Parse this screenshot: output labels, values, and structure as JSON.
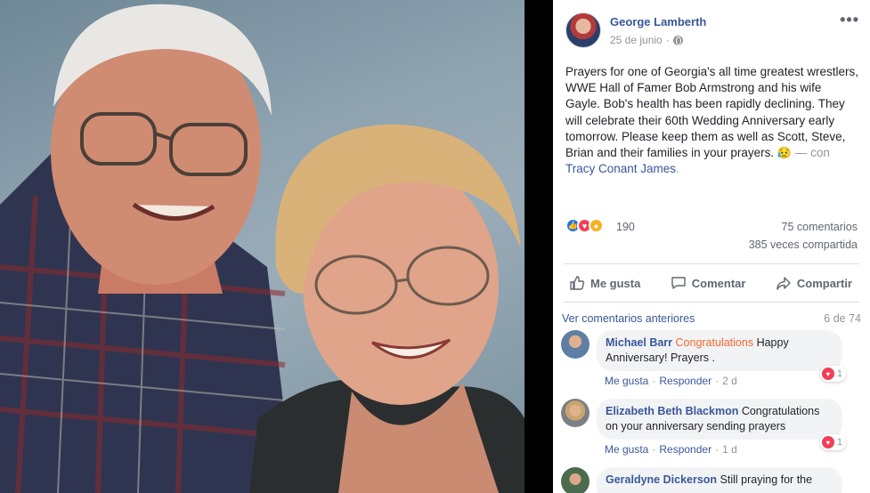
{
  "post": {
    "author": "George Lamberth",
    "date": "25 de junio",
    "dot": "·",
    "more": "•••",
    "text": "Prayers for one of Georgia's all time greatest wrestlers, WWE Hall of Famer Bob Armstrong and his wife Gayle. Bob's health has been rapidly declining. They will celebrate their 60th Wedding Anniversary early tomorrow. Please keep them as well as Scott, Steve, Brian and their families in your prayers.",
    "emoji": "😥",
    "with_label": "— con",
    "tagged": "Tracy Conant James",
    "tag_end": "."
  },
  "reactions": {
    "count": "190",
    "comments": "75 comentarios",
    "shares": "385 veces compartida"
  },
  "actions": {
    "like": "Me gusta",
    "comment": "Comentar",
    "share": "Compartir"
  },
  "comments_section": {
    "view_previous": "Ver comentarios anteriores",
    "count": "6 de 74",
    "items": [
      {
        "name": "Michael Barr",
        "link": "Congratulations",
        "text": "Happy Anniversary! Prayers .",
        "like": "Me gusta",
        "reply": "Responder",
        "time": "2 d",
        "reaction_count": "1"
      },
      {
        "name": "Elizabeth Beth Blackmon",
        "text": "Congratulations on your anniversary sending prayers",
        "like": "Me gusta",
        "reply": "Responder",
        "time": "1 d",
        "reaction_count": "1"
      },
      {
        "name": "Geraldyne Dickerson",
        "text": "Still praying for the"
      }
    ]
  },
  "colors": {
    "link": "#365899",
    "meta": "#90949c",
    "accent_orange": "#f2682a",
    "like_blue": "#1877f2",
    "love_red": "#f33e58"
  }
}
